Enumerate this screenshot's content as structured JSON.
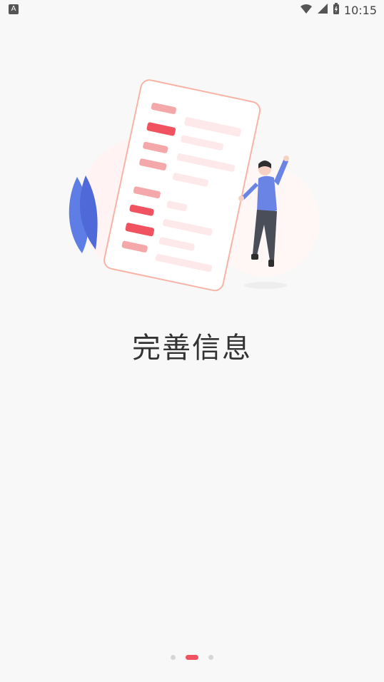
{
  "status_bar": {
    "left_icon_letter": "A",
    "time": "10:15",
    "icons": [
      "wifi-icon",
      "signal-icon",
      "battery-icon"
    ]
  },
  "main": {
    "title": "完善信息"
  },
  "pager": {
    "count": 3,
    "active_index": 1
  },
  "colors": {
    "accent": "#f0525f",
    "phone_outline": "#f7b4a6",
    "person_shirt": "#6a84e6",
    "person_pants": "#4a4e59",
    "dot_inactive": "#d6d6d6"
  }
}
